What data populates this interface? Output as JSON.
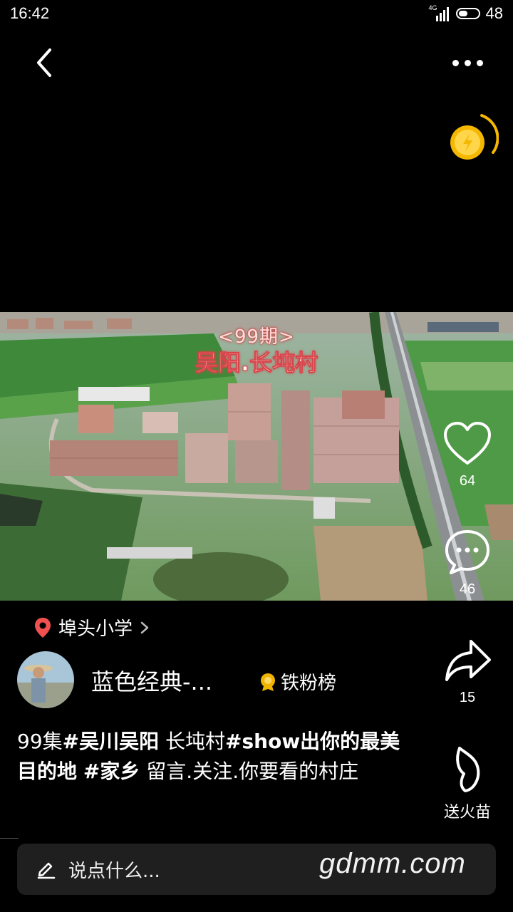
{
  "status_bar": {
    "time": "16:42",
    "network": "4G",
    "battery": "48"
  },
  "video": {
    "overlay_episode": "<99期>",
    "overlay_title": "吴阳.长坉村"
  },
  "actions": {
    "likes": "64",
    "comments": "46",
    "shares": "15",
    "gift_label": "送火苗"
  },
  "location": {
    "name": "埠头小学"
  },
  "author": {
    "name": "蓝色经典-...",
    "badge_label": "铁粉榜"
  },
  "caption": {
    "part1": "99集",
    "tag1": "#吴川吴阳",
    "part2": "  长坉村",
    "tag2": "#show出你的最美目的地",
    "part3": " ",
    "tag3": "#家乡",
    "part4": " 留言.关注.你要看的村庄"
  },
  "comment": {
    "placeholder": "说点什么..."
  },
  "watermark": "gdmm.com",
  "colors": {
    "pin": "#f05050",
    "coin": "#f5b800",
    "background": "#000000"
  }
}
